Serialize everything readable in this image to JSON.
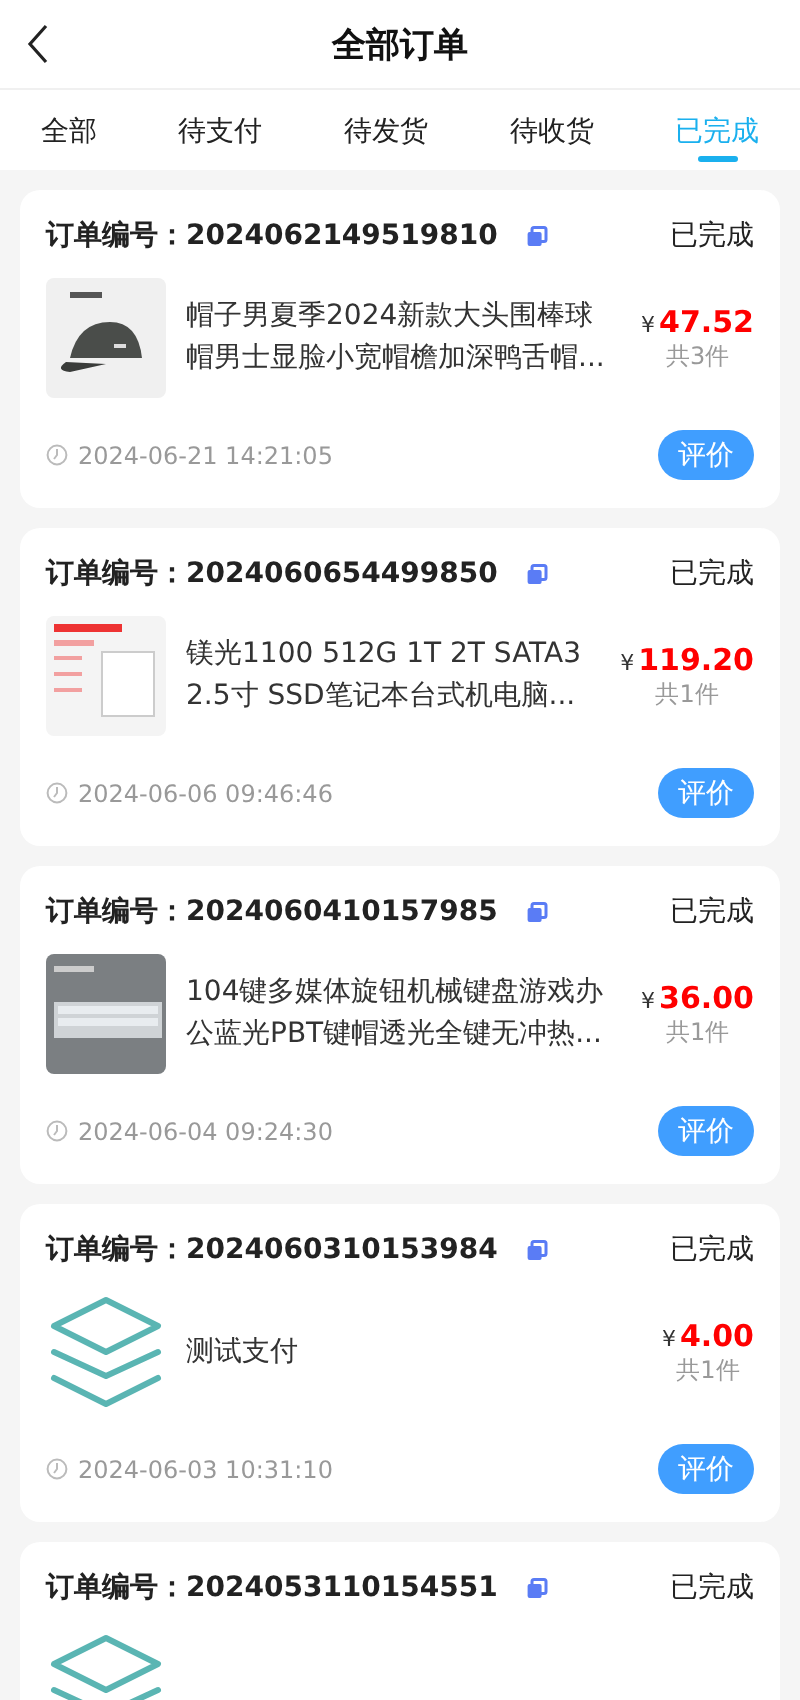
{
  "header": {
    "title": "全部订单"
  },
  "tabs": [
    {
      "label": "全部",
      "selected": false
    },
    {
      "label": "待支付",
      "selected": false
    },
    {
      "label": "待发货",
      "selected": false
    },
    {
      "label": "待收货",
      "selected": false
    },
    {
      "label": "已完成",
      "selected": true
    }
  ],
  "orders": [
    {
      "number_label": "订单编号：2024062149519810",
      "status": "已完成",
      "product": {
        "kind": "picture",
        "title": "帽子男夏季2024新款大头围棒球帽男士显脸小宽帽檐加深鸭舌帽...",
        "currency": "¥",
        "price": "47.52",
        "count": "共3件"
      },
      "time": "2024-06-21 14:21:05",
      "action": "评价"
    },
    {
      "number_label": "订单编号：2024060654499850",
      "status": "已完成",
      "product": {
        "kind": "picture",
        "title": "镁光1100 512G 1T 2T SATA3 2.5寸 SSD笔记本台式机电脑...",
        "currency": "¥",
        "price": "119.20",
        "count": "共1件"
      },
      "time": "2024-06-06 09:46:46",
      "action": "评价"
    },
    {
      "number_label": "订单编号：2024060410157985",
      "status": "已完成",
      "product": {
        "kind": "picture",
        "title": "104键多媒体旋钮机械键盘游戏办公蓝光PBT键帽透光全键无冲热...",
        "currency": "¥",
        "price": "36.00",
        "count": "共1件"
      },
      "time": "2024-06-04 09:24:30",
      "action": "评价"
    },
    {
      "number_label": "订单编号：2024060310153984",
      "status": "已完成",
      "product": {
        "kind": "placeholder",
        "title": "测试支付",
        "currency": "¥",
        "price": "4.00",
        "count": "共1件"
      },
      "time": "2024-06-03 10:31:10",
      "action": "评价"
    },
    {
      "number_label": "订单编号：2024053110154551",
      "status": "已完成",
      "product": {
        "kind": "placeholder"
      }
    }
  ]
}
